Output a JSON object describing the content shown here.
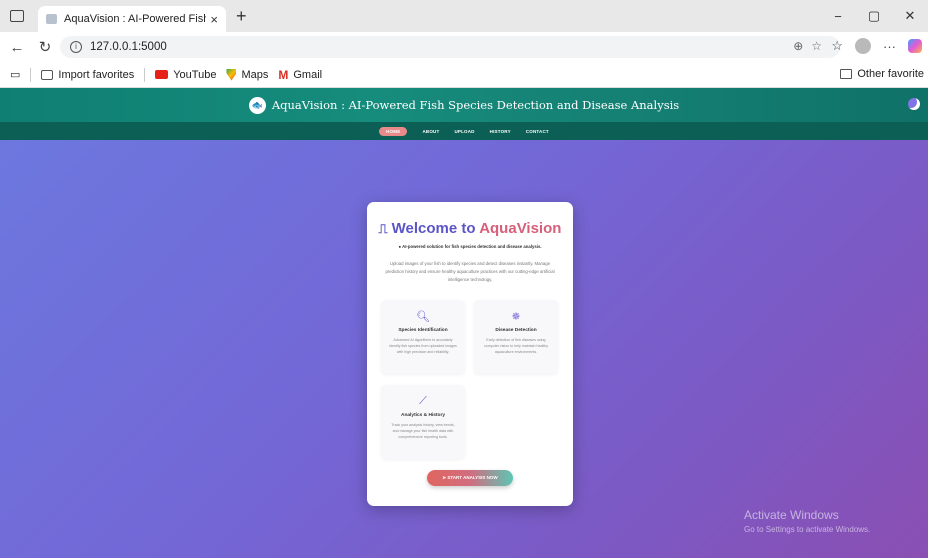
{
  "browser": {
    "tab_title": "AquaVision : AI-Powered Fish Spe",
    "new_tab": "+",
    "tab_close": "×",
    "url": "127.0.0.1:5000",
    "window_controls": [
      "−",
      "▢",
      "✕"
    ],
    "favorites": [
      {
        "label": "Import favorites",
        "icon": "import-icon"
      },
      {
        "label": "YouTube",
        "icon": "youtube-icon"
      },
      {
        "label": "Maps",
        "icon": "maps-icon"
      },
      {
        "label": "Gmail",
        "icon": "gmail-icon"
      }
    ],
    "other_favorites": "Other favorite"
  },
  "site": {
    "title": "AquaVision : AI-Powered Fish Species Detection and Disease Analysis",
    "nav": [
      {
        "label": "HOME",
        "active": true
      },
      {
        "label": "ABOUT"
      },
      {
        "label": "UPLOAD"
      },
      {
        "label": "HISTORY"
      },
      {
        "label": "CONTACT"
      }
    ]
  },
  "card": {
    "welcome_prefix": "Welcome to ",
    "welcome_brand": "AquaVision",
    "subtitle": "AI-powered solution for fish species detection and disease analysis.",
    "description": "Upload images of your fish to identify species and detect diseases instantly. Manage prediction history and ensure healthy aquaculture practices with our cutting-edge artificial intelligence technology.",
    "features": [
      {
        "title": "Species Identification",
        "desc": "Advanced AI algorithms to accurately identify fish species from uploaded images with high precision and reliability.",
        "icon": "search-icon"
      },
      {
        "title": "Disease Detection",
        "desc": "Early detection of fish diseases using computer vision to help maintain healthy aquaculture environments.",
        "icon": "virus-icon"
      },
      {
        "title": "Analytics & History",
        "desc": "Track your analysis history, view trends, and manage your fish health data with comprehensive reporting tools.",
        "icon": "chart-icon"
      }
    ],
    "start_button": "START ANALYSIS NOW"
  },
  "watermark": {
    "line1": "Activate Windows",
    "line2": "Go to Settings to activate Windows."
  },
  "colors": {
    "header": "#157f73",
    "nav": "#0c5f55",
    "accent": "#5b55c8",
    "brand": "#d6607a"
  }
}
